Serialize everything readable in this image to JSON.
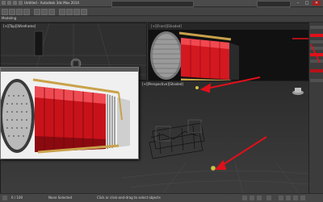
{
  "window": {
    "title": "Untitled - Autodesk 3ds Max 2014",
    "search_placeholder": "Type a keyword or phrase",
    "minimize": "–",
    "maximize": "□",
    "close": "✕"
  },
  "ribbon": {
    "label": "Modeling"
  },
  "viewports": {
    "top_label": "[+][Top][Wireframe]",
    "front_label": "[+][Front][Shaded]",
    "persp_label": "[+][Perspective][Shaded]"
  },
  "status": {
    "frame_counter": "0 / 100",
    "selection": "None Selected",
    "hint": "Click or click-and-drag to select objects"
  },
  "colors": {
    "accent_red": "#e0101a",
    "annotation_arrow": "#e0101a",
    "gold_strap": "#c9a24a"
  },
  "icons": {
    "cmd_panel_active": "red-highlight-icon",
    "view_cube": "view-cube-icon"
  }
}
